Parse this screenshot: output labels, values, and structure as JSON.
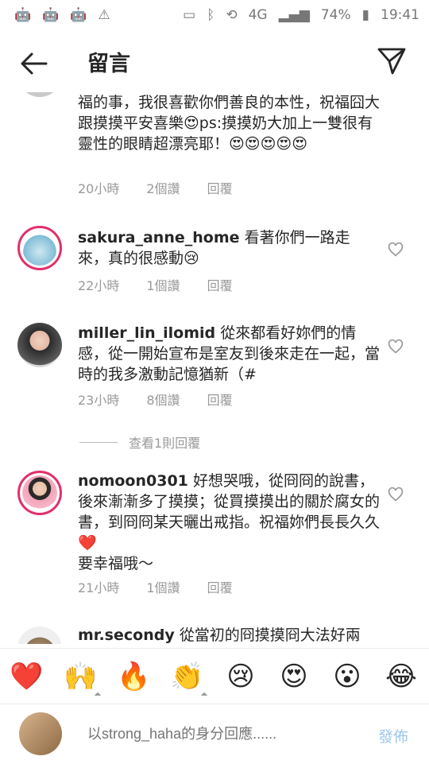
{
  "status": {
    "battery": "74%",
    "time": "19:41",
    "signal": "4G"
  },
  "header": {
    "title": "留言"
  },
  "comments": [
    {
      "user": "",
      "text": "福的事，我很喜歡你們善良的本性，祝福囧大跟摸摸平安喜樂😍ps:摸摸奶大加上一雙很有靈性的眼睛超漂亮耶！😍😍😍😍😍",
      "time": "20小時",
      "likes": "2個讚",
      "reply": "回覆"
    },
    {
      "user": "sakura_anne_home",
      "text": "看著你們一路走來，真的很感動😢",
      "time": "22小時",
      "likes": "1個讚",
      "reply": "回覆"
    },
    {
      "user": "miller_lin_ilomid",
      "text": "從來都看好妳們的情感，從一開始宣布是室友到後來走在一起，當時的我多激動記憶猶新（#",
      "time": "23小時",
      "likes": "8個讚",
      "reply": "回覆"
    },
    {
      "user": "nomoon0301",
      "text": "好想哭哦，從冏冏的說書，後來漸漸多了摸摸；從買摸摸出的關於腐女的書，到冏冏某天曬出戒指。祝福妳們長長久久❤️",
      "text2": "要幸福哦～",
      "time": "21小時",
      "likes": "1個讚",
      "reply": "回覆"
    },
    {
      "user": "mr.secondy",
      "text": "從當初的冏摸摸冏大法好兩"
    }
  ],
  "view_replies": "查看1則回覆",
  "emojis": [
    "❤️",
    "🙌",
    "🔥",
    "👏",
    "😢",
    "😍",
    "😮",
    "😂"
  ],
  "reply_bar": {
    "placeholder": "以strong_haha的身分回應......",
    "post": "發佈"
  }
}
